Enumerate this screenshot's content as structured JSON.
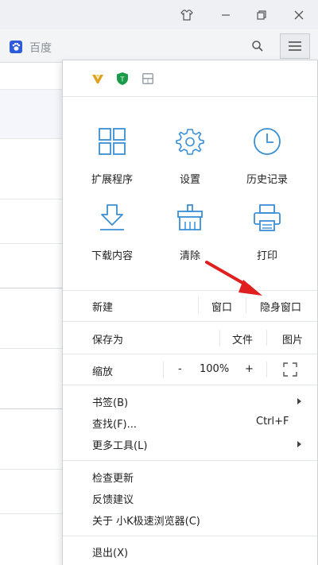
{
  "address_bar": {
    "site_name": "百度"
  },
  "menu": {
    "tiles_row1": [
      {
        "label": "扩展程序"
      },
      {
        "label": "设置"
      },
      {
        "label": "历史记录"
      }
    ],
    "tiles_row2": [
      {
        "label": "下载内容"
      },
      {
        "label": "清除"
      },
      {
        "label": "打印"
      }
    ],
    "new_row": {
      "label": "新建",
      "window": "窗口",
      "incognito": "隐身窗口"
    },
    "saveas_row": {
      "label": "保存为",
      "file": "文件",
      "image": "图片"
    },
    "zoom_row": {
      "label": "缩放",
      "minus": "-",
      "level": "100%",
      "plus": "+"
    },
    "items": {
      "bookmarks": "书签(B)",
      "find": "查找(F)...",
      "find_shortcut": "Ctrl+F",
      "more_tools": "更多工具(L)",
      "check_update": "检查更新",
      "feedback": "反馈建议",
      "about": "关于 小K极速浏览器(C)",
      "exit": "退出(X)"
    }
  },
  "colors": {
    "accent": "#3b8fd4",
    "arrow": "#e02020",
    "ext_shield": "#1a9b4a",
    "ext_bolt": "#e0a020"
  }
}
